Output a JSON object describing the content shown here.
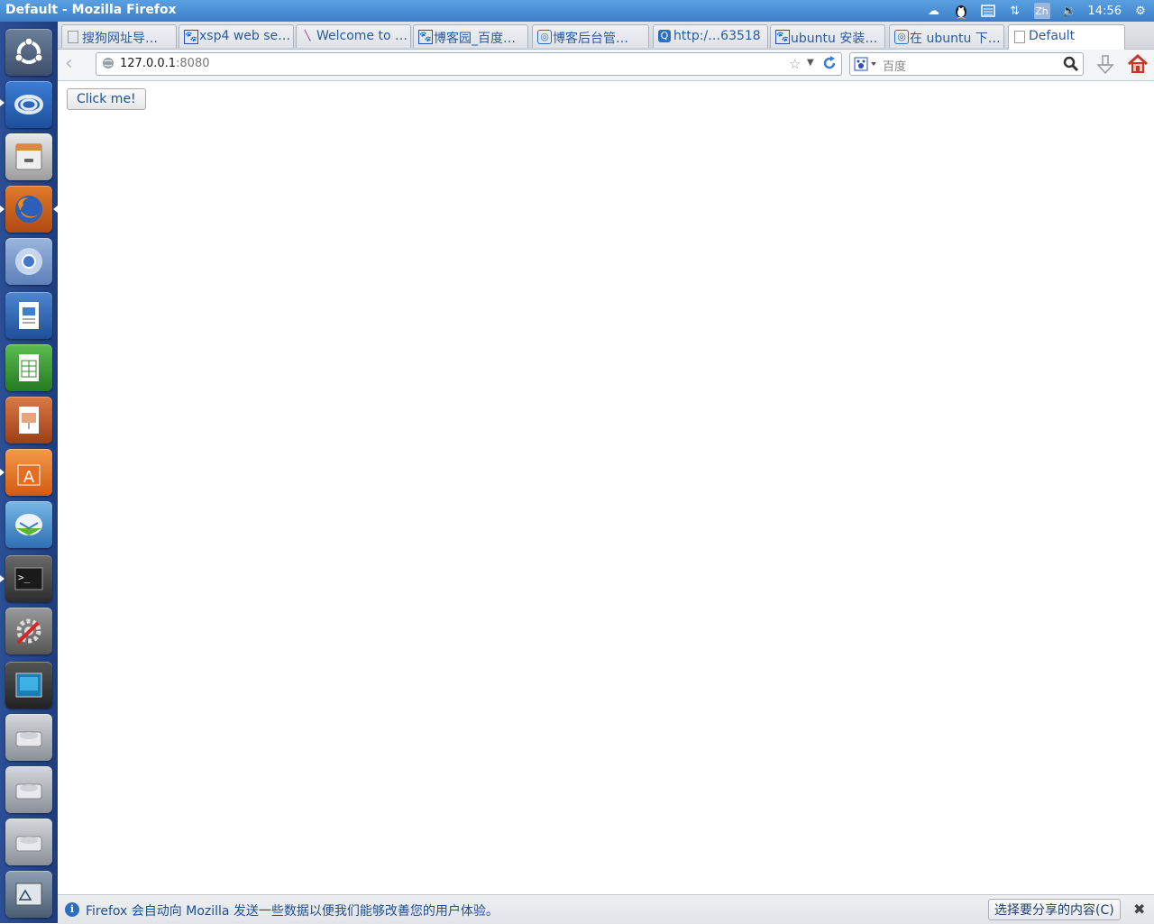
{
  "window": {
    "title": "Default - Mozilla Firefox"
  },
  "tray": {
    "clock": "14:56",
    "lang": "Zh",
    "icons": [
      "weather-icon",
      "qq-penguin-icon",
      "keyboard-icon",
      "network-arrows-icon",
      "lang-indicator",
      "volume-icon",
      "gear-icon"
    ]
  },
  "launcher": {
    "items": [
      "ubuntu-dash-icon",
      "qq-app-icon",
      "file-cabinet-icon",
      "firefox-icon",
      "chromium-icon",
      "writer-icon",
      "calc-icon",
      "impress-icon",
      "software-center-icon",
      "email-client-icon",
      "terminal-icon",
      "system-settings-icon",
      "desktop-viewer-icon",
      "disk-icon",
      "disk-icon",
      "disk-icon",
      "usb-drive-icon"
    ]
  },
  "tabs": [
    {
      "label": "搜狗网址导…",
      "favicon": "blank"
    },
    {
      "label": "xsp4 web se…",
      "favicon": "baidu"
    },
    {
      "label": "Welcome to …",
      "favicon": "feather"
    },
    {
      "label": "博客园_百度…",
      "favicon": "baidu"
    },
    {
      "label": "博客后台管…",
      "favicon": "cnblogs"
    },
    {
      "label": "http:/…63518",
      "favicon": "q"
    },
    {
      "label": "ubuntu 安装…",
      "favicon": "baidu"
    },
    {
      "label": "在 ubuntu 下…",
      "favicon": "cnblogs"
    },
    {
      "label": "Default",
      "favicon": "blank",
      "active": true
    }
  ],
  "nav": {
    "url_host": "127.0.0.1",
    "url_port": ":8080",
    "search_placeholder": "百度"
  },
  "page": {
    "button_label": "Click me!"
  },
  "notification": {
    "text": "Firefox 会自动向 Mozilla 发送一些数据以便我们能够改善您的用户体验。",
    "button": "选择要分享的内容(C)"
  },
  "colors": {
    "title_bar": "#3c7fc9",
    "launcher": "#1e3d80",
    "link_text": "#2a5aa0"
  }
}
